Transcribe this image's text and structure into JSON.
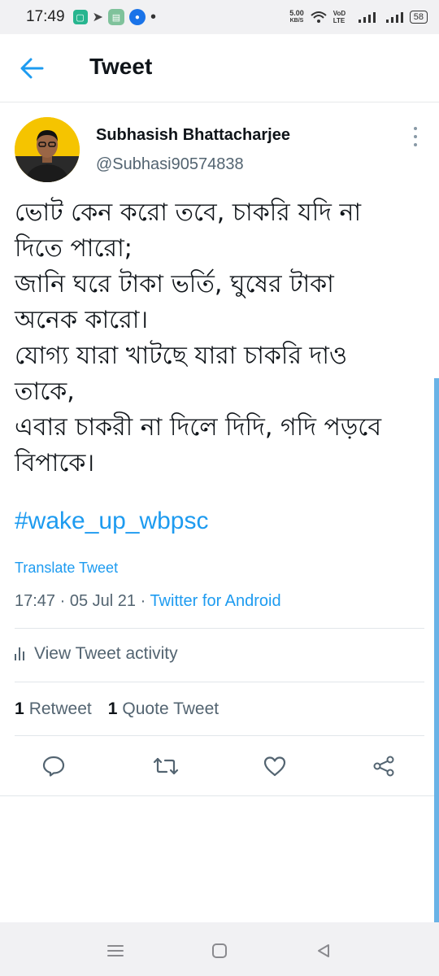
{
  "status_bar": {
    "time": "17:49",
    "speed_top": "5.00",
    "speed_unit": "KB/S",
    "volte": "VoD LTE",
    "battery": "58"
  },
  "header": {
    "title": "Tweet"
  },
  "tweet": {
    "author_name": "Subhasish Bhattacharjee",
    "author_handle": "@Subhasi90574838",
    "body_lines": [
      "ভোট কেন করো তবে, চাকরি যদি না",
      "দিতে পারো;",
      "জানি ঘরে টাকা ভর্তি, ঘুষের টাকা",
      "অনেক কারো।",
      "যোগ্য যারা খাটছে যারা চাকরি দাও",
      "তাকে,",
      "এবার চাকরী না দিলে দিদি, গদি পড়বে",
      "বিপাকে।"
    ],
    "hashtag": "#wake_up_wbpsc",
    "translate": "Translate Tweet",
    "time": "17:47",
    "date": "05 Jul 21",
    "separator": " · ",
    "source": "Twitter for Android",
    "activity_label": "View Tweet activity",
    "retweet_count": "1",
    "retweet_label": "Retweet",
    "quote_count": "1",
    "quote_label": "Quote Tweet"
  },
  "icons": {
    "back": "arrow-left-icon",
    "reply": "reply-icon",
    "retweet": "retweet-icon",
    "like": "heart-icon",
    "share": "share-icon"
  },
  "colors": {
    "accent": "#1d9bf0",
    "secondary_text": "#536471",
    "primary_text": "#0f1419"
  }
}
